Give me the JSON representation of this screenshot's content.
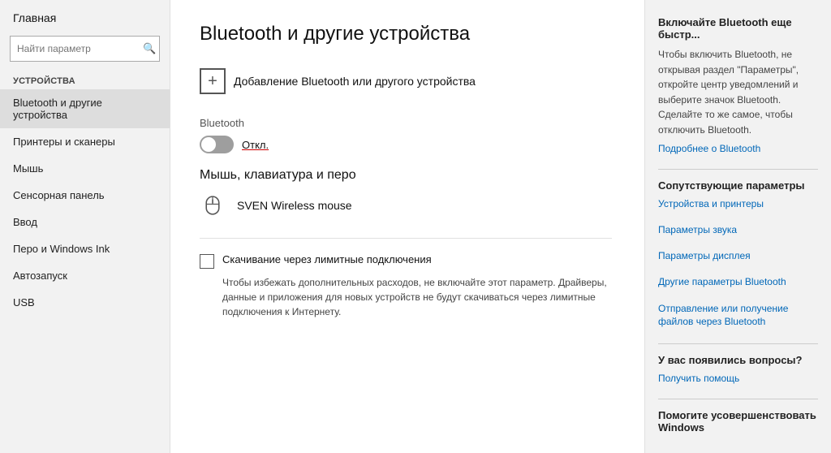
{
  "sidebar": {
    "home_label": "Главная",
    "search_placeholder": "Найти параметр",
    "section_title": "УСТРОЙСТВА",
    "items": [
      {
        "id": "bluetooth",
        "label": "Bluetooth и другие устройства",
        "active": true
      },
      {
        "id": "printers",
        "label": "Принтеры и сканеры",
        "active": false
      },
      {
        "id": "mouse",
        "label": "Мышь",
        "active": false
      },
      {
        "id": "touchpad",
        "label": "Сенсорная панель",
        "active": false
      },
      {
        "id": "input",
        "label": "Ввод",
        "active": false
      },
      {
        "id": "pen",
        "label": "Перо и Windows Ink",
        "active": false
      },
      {
        "id": "autorun",
        "label": "Автозапуск",
        "active": false
      },
      {
        "id": "usb",
        "label": "USB",
        "active": false
      }
    ]
  },
  "main": {
    "page_title": "Bluetooth и другие устройства",
    "add_device_label": "Добавление Bluetooth или другого устройства",
    "bluetooth_section_label": "Bluetooth",
    "bluetooth_toggle_state": "off",
    "bluetooth_toggle_label": "Откл.",
    "mouse_section_title": "Мышь, клавиатура и перо",
    "device_name": "SVEN Wireless mouse",
    "download_section": {
      "checkbox_label": "Скачивание через лимитные подключения",
      "checkbox_desc": "Чтобы избежать дополнительных расходов, не включайте этот параметр. Драйверы, данные и приложения для новых устройств не будут скачиваться через лимитные подключения к Интернету."
    }
  },
  "right_panel": {
    "quick_title": "Включайте Bluetooth еще быстр...",
    "quick_desc": "Чтобы включить Bluetooth, не открывая раздел \"Параметры\", откройте центр уведомлений и выберите значок Bluetooth. Сделайте то же самое, чтобы отключить Bluetooth.",
    "quick_link": "Подробнее о Bluetooth",
    "companion_title": "Сопутствующие параметры",
    "companion_links": [
      "Устройства и принтеры",
      "Параметры звука",
      "Параметры дисплея",
      "Другие параметры Bluetooth",
      "Отправление или получение файлов через Bluetooth"
    ],
    "questions_title": "У вас появились вопросы?",
    "questions_link": "Получить помощь",
    "improve_title": "Помогите усовершенствовать Windows"
  }
}
